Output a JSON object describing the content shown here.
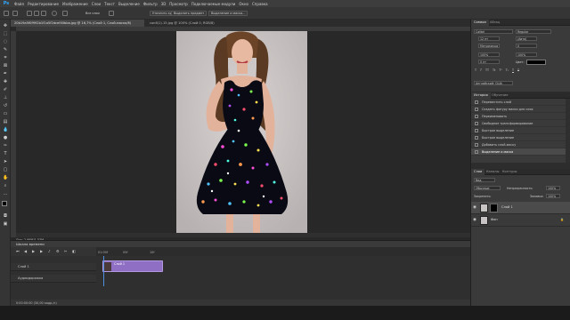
{
  "app": {
    "logo": "Ps"
  },
  "menu": [
    "Файл",
    "Редактирование",
    "Изображение",
    "Слои",
    "Текст",
    "Выделение",
    "Фильтр",
    "3D",
    "Просмотр",
    "Подключаемые модули",
    "Окно",
    "Справка"
  ],
  "options": {
    "sample_label": "Образец:",
    "sample_value": "Все слои",
    "refine_button": "Уточнить край",
    "select_subject": "Выделить предмет",
    "select_mask": "Выделение и маска..."
  },
  "documents": [
    {
      "title": "20b19a5f0f992b1f1a5f2dcef40bba.jpg @ 16,7% (Слой 1, Слой-маска/8)",
      "active": true
    },
    {
      "title": "con6(1).15.jpg @ 100% (Слой 0, RGB/8)",
      "active": false
    }
  ],
  "status_text": "Док: 2,66M/1,53M",
  "timeline": {
    "title": "Шкала времени",
    "ticks": [
      "01:00f",
      "05f",
      "10f"
    ],
    "tracks": [
      "Слой 1",
      "Аудиодорожка"
    ],
    "clip_label": "Слой 1",
    "footer": "0:00:00:00 (30,00 кадр./с)"
  },
  "properties": {
    "tabs": [
      "Символ",
      "Абзац"
    ],
    "font": "Calibri",
    "style": "Regular",
    "size": "12 пт",
    "leading": "(Авто)",
    "kerning": "Метрически",
    "tracking": "0",
    "scale_v": "100%",
    "scale_h": "100%",
    "baseline": "0 пт",
    "color_label": "Цвет:",
    "lang": "Английский: США"
  },
  "history": {
    "tabs": [
      "История",
      "Обучение"
    ],
    "items": [
      "Переместить слой",
      "Создать фигуру маски для слоя",
      "Переименовать",
      "Свободное трансформирование",
      "Быстрое выделение",
      "Быстрое выделение",
      "Добавить слой-маску",
      "Выделение и маска"
    ],
    "selected_index": 7
  },
  "layers": {
    "tabs": [
      "Слои",
      "Каналы",
      "Контуры"
    ],
    "filter_label": "Вид",
    "blend_mode": "Обычные",
    "opacity_label": "Непрозрачность:",
    "opacity_value": "100%",
    "lock_label": "Закрепить:",
    "fill_label": "Заливка:",
    "fill_value": "100%",
    "items": [
      {
        "name": "Слой 1",
        "selected": true
      },
      {
        "name": "Фон",
        "selected": false
      }
    ]
  },
  "colors": {
    "accent": "#31a8ff",
    "clip": "#8e6fc4",
    "dress": "#0a0a14"
  }
}
